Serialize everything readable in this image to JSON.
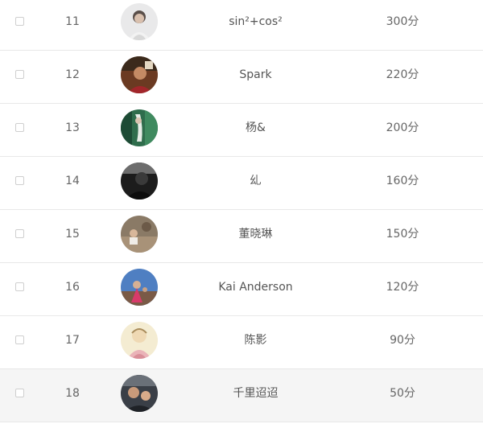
{
  "leaderboard": {
    "rows": [
      {
        "rank": "11",
        "name": "sin²+cos²",
        "score": "300分",
        "avatar": "avatar-photo-icon"
      },
      {
        "rank": "12",
        "name": "Spark",
        "score": "220分",
        "avatar": "avatar-photo-icon"
      },
      {
        "rank": "13",
        "name": "杨&",
        "score": "200分",
        "avatar": "avatar-photo-icon"
      },
      {
        "rank": "14",
        "name": "乣",
        "score": "160分",
        "avatar": "avatar-photo-icon"
      },
      {
        "rank": "15",
        "name": "董晓琳",
        "score": "150分",
        "avatar": "avatar-photo-icon"
      },
      {
        "rank": "16",
        "name": "Kai Anderson",
        "score": "120分",
        "avatar": "avatar-photo-icon"
      },
      {
        "rank": "17",
        "name": "陈影",
        "score": "90分",
        "avatar": "avatar-photo-icon"
      },
      {
        "rank": "18",
        "name": "千里迢迢",
        "score": "50分",
        "avatar": "avatar-photo-icon"
      }
    ]
  },
  "colors": {
    "row_border": "#e8e8e8",
    "highlight_row_bg": "#f5f5f5",
    "text": "#666666"
  }
}
